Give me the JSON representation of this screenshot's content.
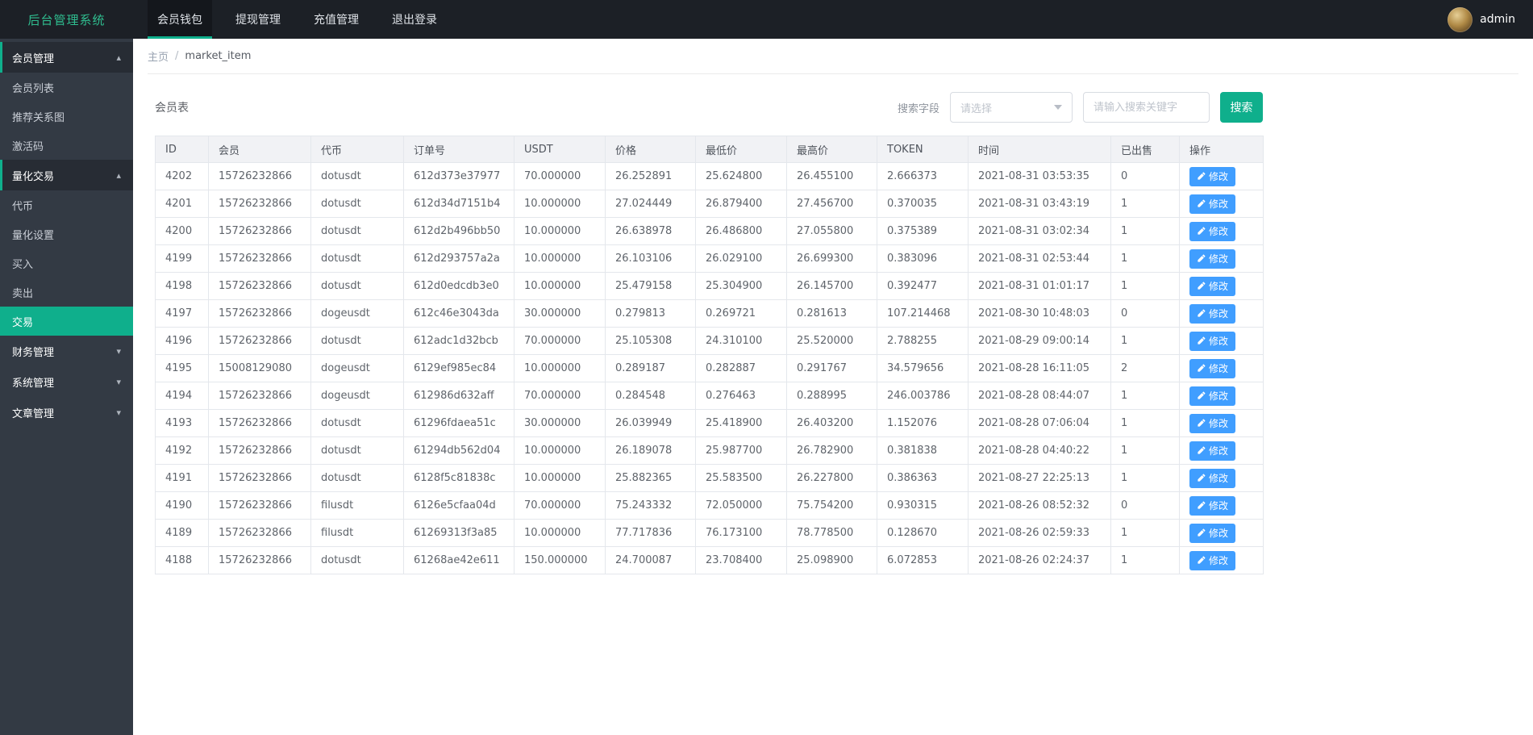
{
  "colors": {
    "accent": "#0faf8c",
    "logo_green": "#2fbd8f",
    "edit_blue": "#409eff",
    "header_bg": "#1c2026",
    "sidebar_bg": "#333a44"
  },
  "header": {
    "title": "后台管理系统",
    "user": "admin",
    "nav": [
      {
        "label": "会员钱包",
        "active": true
      },
      {
        "label": "提现管理",
        "active": false
      },
      {
        "label": "充值管理",
        "active": false
      },
      {
        "label": "退出登录",
        "active": false
      }
    ]
  },
  "sidebar": {
    "items": [
      {
        "label": "会员管理",
        "type": "parent",
        "expanded": true
      },
      {
        "label": "会员列表",
        "type": "child"
      },
      {
        "label": "推荐关系图",
        "type": "child"
      },
      {
        "label": "激活码",
        "type": "child"
      },
      {
        "label": "量化交易",
        "type": "parent",
        "expanded": true
      },
      {
        "label": "代币",
        "type": "child"
      },
      {
        "label": "量化设置",
        "type": "child"
      },
      {
        "label": "买入",
        "type": "child"
      },
      {
        "label": "卖出",
        "type": "child"
      },
      {
        "label": "交易",
        "type": "child",
        "active": true
      },
      {
        "label": "财务管理",
        "type": "parent",
        "expanded": false
      },
      {
        "label": "系统管理",
        "type": "parent",
        "expanded": false
      },
      {
        "label": "文章管理",
        "type": "parent",
        "expanded": false
      }
    ]
  },
  "breadcrumb": {
    "home": "主页",
    "separator": "/",
    "current": "market_item"
  },
  "toolbar": {
    "panel_title": "会员表",
    "search_label": "搜索字段",
    "select_placeholder": "请选择",
    "input_placeholder": "请输入搜索关键字",
    "search_button": "搜索"
  },
  "table": {
    "headers": [
      "ID",
      "会员",
      "代币",
      "订单号",
      "USDT",
      "价格",
      "最低价",
      "最高价",
      "TOKEN",
      "时间",
      "已出售",
      "操作"
    ],
    "edit_button": "修改",
    "rows": [
      [
        "4202",
        "15726232866",
        "dotusdt",
        "612d373e37977",
        "70.000000",
        "26.252891",
        "25.624800",
        "26.455100",
        "2.666373",
        "2021-08-31 03:53:35",
        "0"
      ],
      [
        "4201",
        "15726232866",
        "dotusdt",
        "612d34d7151b4",
        "10.000000",
        "27.024449",
        "26.879400",
        "27.456700",
        "0.370035",
        "2021-08-31 03:43:19",
        "1"
      ],
      [
        "4200",
        "15726232866",
        "dotusdt",
        "612d2b496bb50",
        "10.000000",
        "26.638978",
        "26.486800",
        "27.055800",
        "0.375389",
        "2021-08-31 03:02:34",
        "1"
      ],
      [
        "4199",
        "15726232866",
        "dotusdt",
        "612d293757a2a",
        "10.000000",
        "26.103106",
        "26.029100",
        "26.699300",
        "0.383096",
        "2021-08-31 02:53:44",
        "1"
      ],
      [
        "4198",
        "15726232866",
        "dotusdt",
        "612d0edcdb3e0",
        "10.000000",
        "25.479158",
        "25.304900",
        "26.145700",
        "0.392477",
        "2021-08-31 01:01:17",
        "1"
      ],
      [
        "4197",
        "15726232866",
        "dogeusdt",
        "612c46e3043da",
        "30.000000",
        "0.279813",
        "0.269721",
        "0.281613",
        "107.214468",
        "2021-08-30 10:48:03",
        "0"
      ],
      [
        "4196",
        "15726232866",
        "dotusdt",
        "612adc1d32bcb",
        "70.000000",
        "25.105308",
        "24.310100",
        "25.520000",
        "2.788255",
        "2021-08-29 09:00:14",
        "1"
      ],
      [
        "4195",
        "15008129080",
        "dogeusdt",
        "6129ef985ec84",
        "10.000000",
        "0.289187",
        "0.282887",
        "0.291767",
        "34.579656",
        "2021-08-28 16:11:05",
        "2"
      ],
      [
        "4194",
        "15726232866",
        "dogeusdt",
        "612986d632aff",
        "70.000000",
        "0.284548",
        "0.276463",
        "0.288995",
        "246.003786",
        "2021-08-28 08:44:07",
        "1"
      ],
      [
        "4193",
        "15726232866",
        "dotusdt",
        "61296fdaea51c",
        "30.000000",
        "26.039949",
        "25.418900",
        "26.403200",
        "1.152076",
        "2021-08-28 07:06:04",
        "1"
      ],
      [
        "4192",
        "15726232866",
        "dotusdt",
        "61294db562d04",
        "10.000000",
        "26.189078",
        "25.987700",
        "26.782900",
        "0.381838",
        "2021-08-28 04:40:22",
        "1"
      ],
      [
        "4191",
        "15726232866",
        "dotusdt",
        "6128f5c81838c",
        "10.000000",
        "25.882365",
        "25.583500",
        "26.227800",
        "0.386363",
        "2021-08-27 22:25:13",
        "1"
      ],
      [
        "4190",
        "15726232866",
        "filusdt",
        "6126e5cfaa04d",
        "70.000000",
        "75.243332",
        "72.050000",
        "75.754200",
        "0.930315",
        "2021-08-26 08:52:32",
        "0"
      ],
      [
        "4189",
        "15726232866",
        "filusdt",
        "61269313f3a85",
        "10.000000",
        "77.717836",
        "76.173100",
        "78.778500",
        "0.128670",
        "2021-08-26 02:59:33",
        "1"
      ],
      [
        "4188",
        "15726232866",
        "dotusdt",
        "61268ae42e611",
        "150.000000",
        "24.700087",
        "23.708400",
        "25.098900",
        "6.072853",
        "2021-08-26 02:24:37",
        "1"
      ]
    ]
  }
}
